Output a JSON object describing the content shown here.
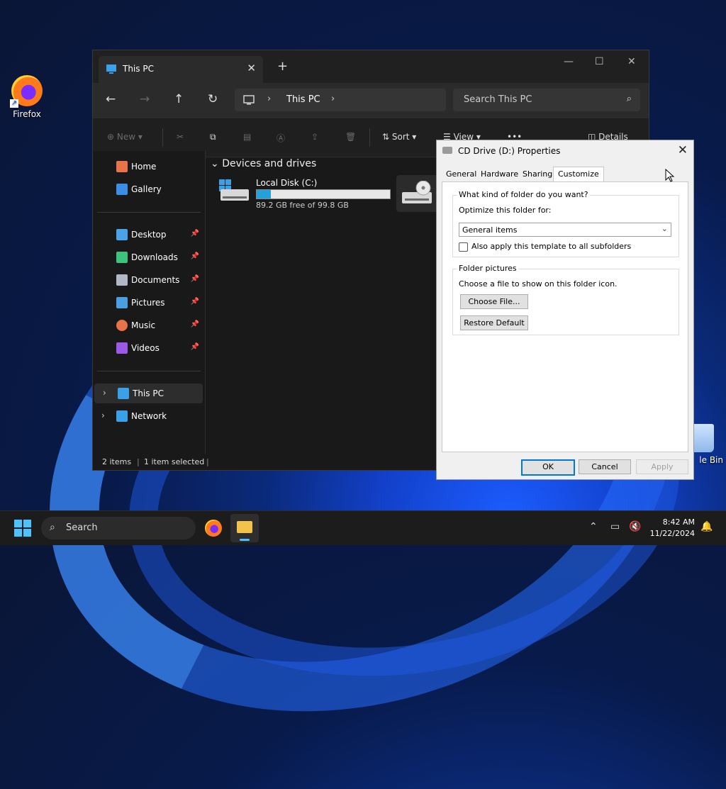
{
  "desktop": {
    "icons": [
      {
        "label": "Firefox"
      },
      {
        "label": "le Bin"
      }
    ]
  },
  "explorer": {
    "tab_title": "This PC",
    "new_tab": "+",
    "window_controls": {
      "minimize": "—",
      "maximize": "☐",
      "close": "✕"
    },
    "address": {
      "crumb": "This PC",
      "sep": "›"
    },
    "search_placeholder": "Search This PC",
    "toolbar": {
      "new_label": "New",
      "sort_label": "Sort",
      "view_label": "View",
      "more_label": "•••",
      "details_label": "Details"
    },
    "sidebar": [
      {
        "label": "Home",
        "color": "#e8734a"
      },
      {
        "label": "Gallery",
        "color": "#3a8ee6"
      },
      {
        "label": "Desktop",
        "color": "#4aa3e6",
        "pinned": true
      },
      {
        "label": "Downloads",
        "color": "#3cc47c",
        "pinned": true
      },
      {
        "label": "Documents",
        "color": "#b0b8c8",
        "pinned": true
      },
      {
        "label": "Pictures",
        "color": "#4a9fe0",
        "pinned": true
      },
      {
        "label": "Music",
        "color": "#e8734a",
        "pinned": true
      },
      {
        "label": "Videos",
        "color": "#9b59e6",
        "pinned": true
      },
      {
        "label": "This PC",
        "color": "#3aa0e8"
      },
      {
        "label": "Network",
        "color": "#3aa0e8"
      }
    ],
    "group_title": "Devices and drives",
    "drives": [
      {
        "name": "Local Disk (C:)",
        "free_text": "89.2 GB free of 99.8 GB",
        "used_fraction": 0.106
      }
    ],
    "status": {
      "items": "2 items",
      "selected": "1 item selected"
    }
  },
  "dialog": {
    "title": "CD Drive (D:) Properties",
    "tabs": [
      "General",
      "Hardware",
      "Sharing",
      "Customize"
    ],
    "active_tab": "Customize",
    "group1": {
      "legend": "What kind of folder do you want?",
      "optimize_label": "Optimize this folder for:",
      "combo_value": "General items",
      "checkbox_label": "Also apply this template to all subfolders"
    },
    "group2": {
      "legend": "Folder pictures",
      "choose_text": "Choose a file to show on this folder icon.",
      "choose_btn": "Choose File...",
      "restore_btn": "Restore Default"
    },
    "buttons": {
      "ok": "OK",
      "cancel": "Cancel",
      "apply": "Apply"
    }
  },
  "taskbar": {
    "search_placeholder": "Search",
    "time": "8:42 AM",
    "date": "11/22/2024"
  }
}
